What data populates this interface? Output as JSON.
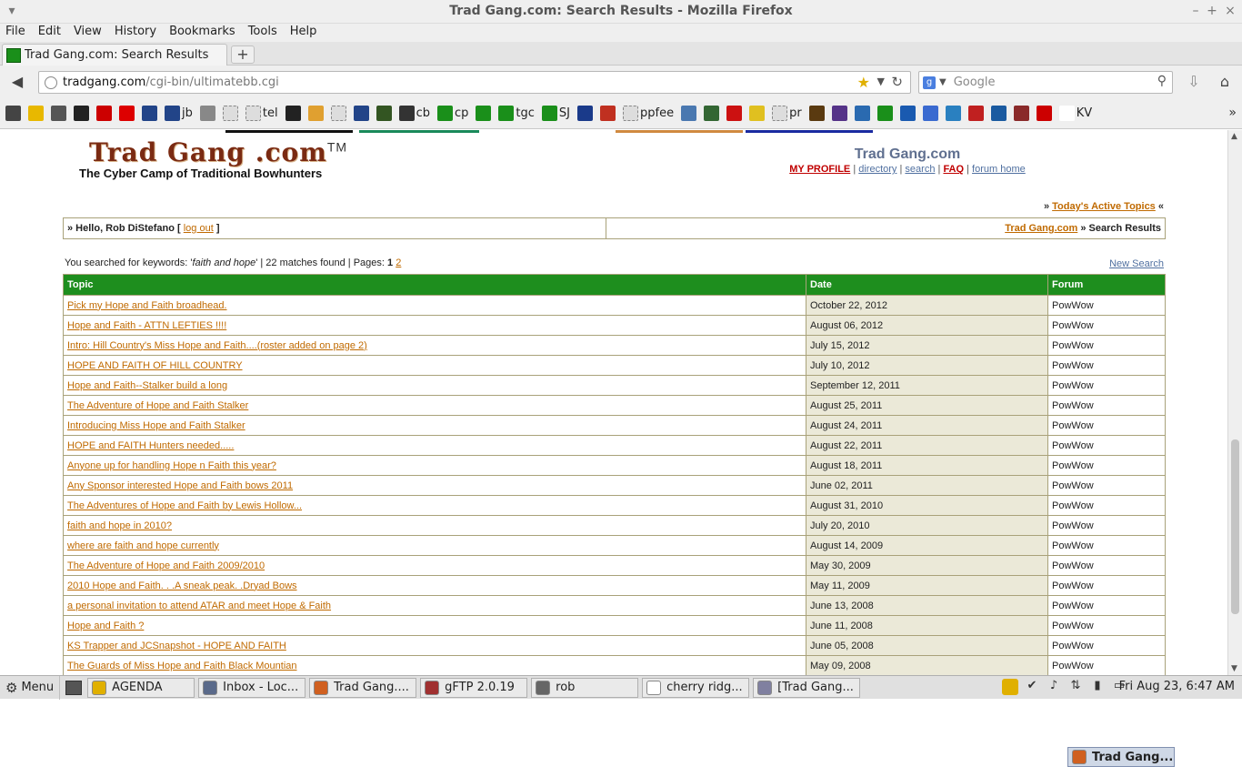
{
  "window": {
    "title": "Trad Gang.com: Search Results - Mozilla Firefox"
  },
  "menubar": [
    "File",
    "Edit",
    "View",
    "History",
    "Bookmarks",
    "Tools",
    "Help"
  ],
  "tab": {
    "label": "Trad Gang.com: Search Results",
    "new_tab": "+"
  },
  "urlbar": {
    "host": "tradgang.com",
    "path": "/cgi-bin/ultimatebb.cgi"
  },
  "searchbar": {
    "placeholder": "Google"
  },
  "bookmarks": [
    {
      "label": "",
      "color": "#444"
    },
    {
      "label": "",
      "color": "#e8b800"
    },
    {
      "label": "",
      "color": "#555"
    },
    {
      "label": "",
      "color": "#222"
    },
    {
      "label": "",
      "color": "#c00"
    },
    {
      "label": "",
      "color": "#d00"
    },
    {
      "label": "",
      "color": "#224488"
    },
    {
      "label": "jb",
      "color": "#224488"
    },
    {
      "label": "",
      "color": "#888"
    },
    {
      "label": "",
      "color": "#ddd"
    },
    {
      "label": "tel",
      "color": "#ddd"
    },
    {
      "label": "",
      "color": "#222"
    },
    {
      "label": "",
      "color": "#e0a030"
    },
    {
      "label": "",
      "color": "#ddd"
    },
    {
      "label": "",
      "color": "#224488"
    },
    {
      "label": "",
      "color": "#335522"
    },
    {
      "label": "cb",
      "color": "#333"
    },
    {
      "label": "cp",
      "color": "#1a8f1a"
    },
    {
      "label": "",
      "color": "#1a8f1a"
    },
    {
      "label": "tgc",
      "color": "#1a8f1a"
    },
    {
      "label": "SJ",
      "color": "#1a8f1a"
    },
    {
      "label": "",
      "color": "#1a3a8a"
    },
    {
      "label": "",
      "color": "#c03020"
    },
    {
      "label": "ppfee",
      "color": "#ddd"
    },
    {
      "label": "",
      "color": "#4a78b0"
    },
    {
      "label": "",
      "color": "#336633"
    },
    {
      "label": "",
      "color": "#cc1111"
    },
    {
      "label": "",
      "color": "#e0c020"
    },
    {
      "label": "pr",
      "color": "#ddd"
    },
    {
      "label": "",
      "color": "#5a3a10"
    },
    {
      "label": "",
      "color": "#553388"
    },
    {
      "label": "",
      "color": "#2a6ab0"
    },
    {
      "label": "",
      "color": "#1a8f1a"
    },
    {
      "label": "",
      "color": "#1a5ab0"
    },
    {
      "label": "",
      "color": "#3a6ad0"
    },
    {
      "label": "",
      "color": "#2a80c0"
    },
    {
      "label": "",
      "color": "#c02020"
    },
    {
      "label": "",
      "color": "#1a5aa0"
    },
    {
      "label": "",
      "color": "#8a2a2a"
    },
    {
      "label": "",
      "color": "#cc0000"
    },
    {
      "label": "KV",
      "color": "#ffffff"
    }
  ],
  "site": {
    "logo": "Trad Gang .com",
    "logo_tm": "TM",
    "tagline": "The Cyber Camp of Traditional Bowhunters",
    "name": "Trad Gang.com",
    "links": {
      "my_profile": "MY PROFILE",
      "directory": "directory",
      "search": "search",
      "faq": "FAQ",
      "forum_home": "forum home"
    },
    "active_topics": "Today's Active Topics"
  },
  "hello": {
    "prefix": "» Hello, Rob DiStefano [ ",
    "logout": "log out",
    "suffix": " ]",
    "crumb_link": "Trad Gang.com",
    "crumb_current": " » Search Results"
  },
  "search": {
    "prefix": "You searched for keywords: '",
    "keywords": "faith and hope",
    "matches": "'  |  22 matches found  |  Pages: ",
    "page_current": "1",
    "page_next": "2",
    "new_search": "New Search"
  },
  "table": {
    "headers": [
      "Topic",
      "Date",
      "Forum"
    ],
    "rows": [
      {
        "topic": "Pick my Hope and Faith broadhead.",
        "date": "October 22, 2012",
        "forum": "PowWow"
      },
      {
        "topic": "Hope and Faith - ATTN LEFTIES !!!!",
        "date": "August 06, 2012",
        "forum": "PowWow"
      },
      {
        "topic": "Intro: Hill Country's Miss Hope and Faith....(roster added on page 2)",
        "date": "July 15, 2012",
        "forum": "PowWow"
      },
      {
        "topic": "HOPE AND FAITH OF HILL COUNTRY",
        "date": "July 10, 2012",
        "forum": "PowWow"
      },
      {
        "topic": "Hope and Faith--Stalker build a long",
        "date": "September 12, 2011",
        "forum": "PowWow"
      },
      {
        "topic": "The Adventure of Hope and Faith Stalker",
        "date": "August 25, 2011",
        "forum": "PowWow"
      },
      {
        "topic": "Introducing Miss Hope and Faith Stalker",
        "date": "August 24, 2011",
        "forum": "PowWow"
      },
      {
        "topic": "HOPE and FAITH Hunters needed.....",
        "date": "August 22, 2011",
        "forum": "PowWow"
      },
      {
        "topic": "Anyone up for handling Hope n Faith this year?",
        "date": "August 18, 2011",
        "forum": "PowWow"
      },
      {
        "topic": "Any Sponsor interested Hope and Faith bows 2011",
        "date": "June 02, 2011",
        "forum": "PowWow"
      },
      {
        "topic": "The Adventures of Hope and Faith by Lewis Hollow...",
        "date": "August 31, 2010",
        "forum": "PowWow"
      },
      {
        "topic": "faith and hope in 2010?",
        "date": "July 20, 2010",
        "forum": "PowWow"
      },
      {
        "topic": "where are faith and hope currently",
        "date": "August 14, 2009",
        "forum": "PowWow"
      },
      {
        "topic": "The Adventure of Hope and Faith 2009/2010",
        "date": "May 30, 2009",
        "forum": "PowWow"
      },
      {
        "topic": "2010 Hope and Faith. . .A sneak peak. .Dryad Bows",
        "date": "May 11, 2009",
        "forum": "PowWow"
      },
      {
        "topic": "a personal invitation to attend ATAR and meet Hope & Faith",
        "date": "June 13, 2008",
        "forum": "PowWow"
      },
      {
        "topic": "Hope and Faith ?",
        "date": "June 11, 2008",
        "forum": "PowWow"
      },
      {
        "topic": "KS Trapper and JCSnapshot - HOPE AND FAITH",
        "date": "June 05, 2008",
        "forum": "PowWow"
      },
      {
        "topic": "The Guards of Miss Hope and Faith Black Mountian",
        "date": "May 09, 2008",
        "forum": "PowWow"
      }
    ]
  },
  "taskbar": {
    "menu": "Menu",
    "tasks": [
      {
        "label": "AGENDA",
        "color": "#e0b000",
        "active": false
      },
      {
        "label": "Inbox - Loc...",
        "color": "#5a6a8a",
        "active": false
      },
      {
        "label": "Trad Gang....",
        "color": "#d06020",
        "active": false
      },
      {
        "label": "gFTP 2.0.19",
        "color": "#a03030",
        "active": false
      },
      {
        "label": "rob",
        "color": "#666666",
        "active": false
      },
      {
        "label": "cherry ridg...",
        "color": "#ffffff",
        "active": false
      },
      {
        "label": "[Trad Gang...",
        "color": "#8080a0",
        "active": false
      },
      {
        "label": "Trad Gang....",
        "color": "#d06020",
        "active": true
      }
    ],
    "clock": "Fri Aug 23,  6:47 AM"
  }
}
